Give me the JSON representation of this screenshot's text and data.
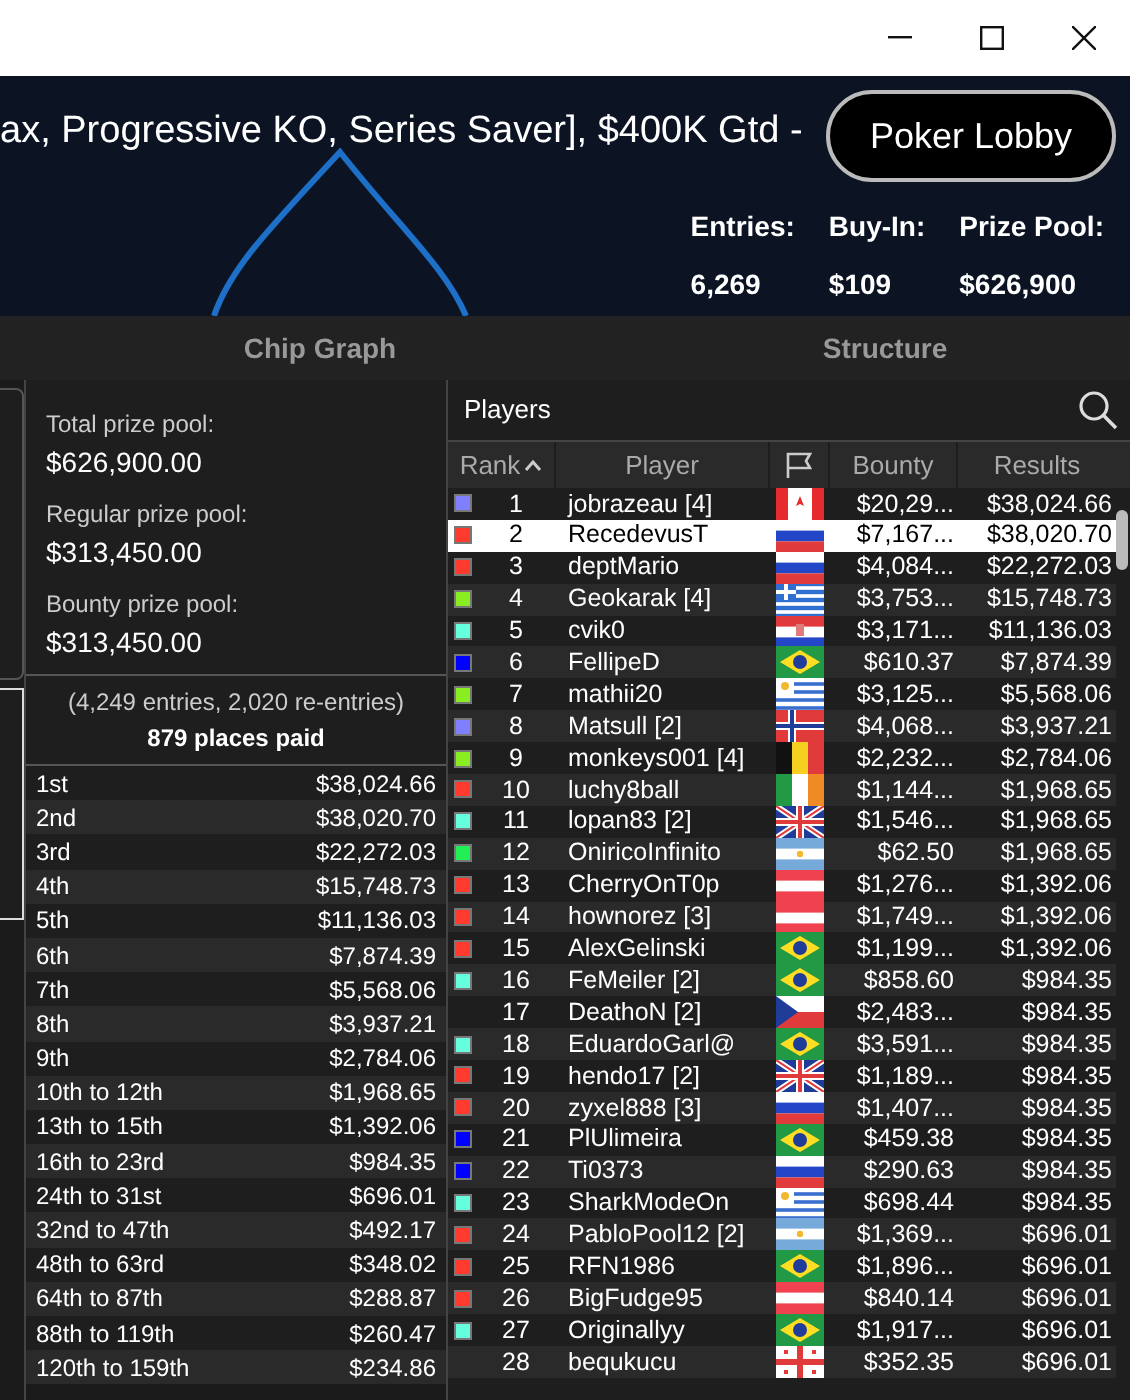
{
  "header": {
    "title": "ax, Progressive KO, Series Saver], $400K Gtd -",
    "lobby_button": "Poker Lobby",
    "stats": [
      {
        "label": "Entries:",
        "value": "6,269"
      },
      {
        "label": "Buy-In:",
        "value": "$109"
      },
      {
        "label": "Prize Pool:",
        "value": "$626,900"
      }
    ]
  },
  "tabs": [
    {
      "label": "Chip Graph",
      "selected": false
    },
    {
      "label": "Structure",
      "selected": false
    }
  ],
  "prize_summary": [
    {
      "label": "Total prize pool:",
      "value": "$626,900.00"
    },
    {
      "label": "Regular prize pool:",
      "value": "$313,450.00"
    },
    {
      "label": "Bounty prize pool:",
      "value": "$313,450.00"
    }
  ],
  "entries_note": "(4,249 entries, 2,020 re-entries)",
  "places_paid": "879 places paid",
  "payouts": [
    {
      "place": "1st",
      "amount": "$38,024.66"
    },
    {
      "place": "2nd",
      "amount": "$38,020.70"
    },
    {
      "place": "3rd",
      "amount": "$22,272.03"
    },
    {
      "place": "4th",
      "amount": "$15,748.73"
    },
    {
      "place": "5th",
      "amount": "$11,136.03"
    },
    {
      "place": "6th",
      "amount": "$7,874.39"
    },
    {
      "place": "7th",
      "amount": "$5,568.06"
    },
    {
      "place": "8th",
      "amount": "$3,937.21"
    },
    {
      "place": "9th",
      "amount": "$2,784.06"
    },
    {
      "place": "10th to 12th",
      "amount": "$1,968.65"
    },
    {
      "place": "13th to 15th",
      "amount": "$1,392.06"
    },
    {
      "place": "16th to 23rd",
      "amount": "$984.35"
    },
    {
      "place": "24th to 31st",
      "amount": "$696.01"
    },
    {
      "place": "32nd to 47th",
      "amount": "$492.17"
    },
    {
      "place": "48th to 63rd",
      "amount": "$348.02"
    },
    {
      "place": "64th to 87th",
      "amount": "$288.87"
    },
    {
      "place": "88th to 119th",
      "amount": "$260.47"
    },
    {
      "place": "120th to 159th",
      "amount": "$234.86"
    }
  ],
  "players": {
    "title": "Players",
    "columns": [
      "Rank",
      "Player",
      "Bounty",
      "Results"
    ],
    "rows": [
      {
        "rank": "1",
        "name": "jobrazeau [4]",
        "flag": {
          "kind": "ca"
        },
        "bounty": "$20,29...",
        "result": "$38,024.66",
        "color": "#8080ff",
        "selected": false
      },
      {
        "rank": "2",
        "name": "RecedevusT",
        "flag": {
          "kind": "ru"
        },
        "bounty": "$7,167...",
        "result": "$38,020.70",
        "color": "#ff3b30",
        "selected": true
      },
      {
        "rank": "3",
        "name": "deptMario",
        "flag": {
          "kind": "ru"
        },
        "bounty": "$4,084...",
        "result": "$22,272.03",
        "color": "#ff3b30",
        "selected": false
      },
      {
        "rank": "4",
        "name": "Geokarak [4]",
        "flag": {
          "kind": "gr"
        },
        "bounty": "$3,753...",
        "result": "$15,748.73",
        "color": "#88ee22",
        "selected": false
      },
      {
        "rank": "5",
        "name": "cvik0",
        "flag": {
          "kind": "hr"
        },
        "bounty": "$3,171...",
        "result": "$11,136.03",
        "color": "#66ffdd",
        "selected": false
      },
      {
        "rank": "6",
        "name": "FellipeD",
        "flag": {
          "kind": "br"
        },
        "bounty": "$610.37",
        "result": "$7,874.39",
        "color": "#0000ff",
        "selected": false
      },
      {
        "rank": "7",
        "name": "mathii20",
        "flag": {
          "kind": "uy"
        },
        "bounty": "$3,125...",
        "result": "$5,568.06",
        "color": "#88ee22",
        "selected": false
      },
      {
        "rank": "8",
        "name": "Matsull [2]",
        "flag": {
          "kind": "no"
        },
        "bounty": "$4,068...",
        "result": "$3,937.21",
        "color": "#8080ff",
        "selected": false
      },
      {
        "rank": "9",
        "name": "monkeys001 [4]",
        "flag": {
          "kind": "be"
        },
        "bounty": "$2,232...",
        "result": "$2,784.06",
        "color": "#88ee22",
        "selected": false
      },
      {
        "rank": "10",
        "name": "luchy8ball",
        "flag": {
          "kind": "ie"
        },
        "bounty": "$1,144...",
        "result": "$1,968.65",
        "color": "#ff3b30",
        "selected": false
      },
      {
        "rank": "11",
        "name": "lopan83 [2]",
        "flag": {
          "kind": "gb"
        },
        "bounty": "$1,546...",
        "result": "$1,968.65",
        "color": "#66ffdd",
        "selected": false
      },
      {
        "rank": "12",
        "name": "OniricoInfinito",
        "flag": {
          "kind": "ar"
        },
        "bounty": "$62.50",
        "result": "$1,968.65",
        "color": "#22ee55",
        "selected": false
      },
      {
        "rank": "13",
        "name": "CherryOnT0p",
        "flag": {
          "kind": "at"
        },
        "bounty": "$1,276...",
        "result": "$1,392.06",
        "color": "#ff3b30",
        "selected": false
      },
      {
        "rank": "14",
        "name": "hownorez [3]",
        "flag": {
          "kind": "at"
        },
        "bounty": "$1,749...",
        "result": "$1,392.06",
        "color": "#ff3b30",
        "selected": false
      },
      {
        "rank": "15",
        "name": "AlexGelinski",
        "flag": {
          "kind": "br"
        },
        "bounty": "$1,199...",
        "result": "$1,392.06",
        "color": "#ff3b30",
        "selected": false
      },
      {
        "rank": "16",
        "name": "FeMeiler [2]",
        "flag": {
          "kind": "br"
        },
        "bounty": "$858.60",
        "result": "$984.35",
        "color": "#66ffdd",
        "selected": false
      },
      {
        "rank": "17",
        "name": "DeathoN [2]",
        "flag": {
          "kind": "cz"
        },
        "bounty": "$2,483...",
        "result": "$984.35",
        "selected": false
      },
      {
        "rank": "18",
        "name": "EduardoGarl@",
        "flag": {
          "kind": "br"
        },
        "bounty": "$3,591...",
        "result": "$984.35",
        "color": "#66ffdd",
        "selected": false
      },
      {
        "rank": "19",
        "name": "hendo17 [2]",
        "flag": {
          "kind": "gb"
        },
        "bounty": "$1,189...",
        "result": "$984.35",
        "color": "#ff3b30",
        "selected": false
      },
      {
        "rank": "20",
        "name": "zyxel888 [3]",
        "flag": {
          "kind": "ru"
        },
        "bounty": "$1,407...",
        "result": "$984.35",
        "color": "#ff3b30",
        "selected": false
      },
      {
        "rank": "21",
        "name": "PlUlimeira",
        "flag": {
          "kind": "br"
        },
        "bounty": "$459.38",
        "result": "$984.35",
        "color": "#0000ff",
        "selected": false
      },
      {
        "rank": "22",
        "name": "Ti0373",
        "flag": {
          "kind": "ru"
        },
        "bounty": "$290.63",
        "result": "$984.35",
        "color": "#0000ff",
        "selected": false
      },
      {
        "rank": "23",
        "name": "SharkModeOn",
        "flag": {
          "kind": "uy"
        },
        "bounty": "$698.44",
        "result": "$984.35",
        "color": "#66ffdd",
        "selected": false
      },
      {
        "rank": "24",
        "name": "PabloPool12 [2]",
        "flag": {
          "kind": "ar"
        },
        "bounty": "$1,369...",
        "result": "$696.01",
        "color": "#ff3b30",
        "selected": false
      },
      {
        "rank": "25",
        "name": "RFN1986",
        "flag": {
          "kind": "br"
        },
        "bounty": "$1,896...",
        "result": "$696.01",
        "color": "#ff3b30",
        "selected": false
      },
      {
        "rank": "26",
        "name": "BigFudge95",
        "flag": {
          "kind": "at"
        },
        "bounty": "$840.14",
        "result": "$696.01",
        "color": "#ff3b30",
        "selected": false
      },
      {
        "rank": "27",
        "name": "Originallyy",
        "flag": {
          "kind": "br"
        },
        "bounty": "$1,917...",
        "result": "$696.01",
        "color": "#66ffdd",
        "selected": false
      },
      {
        "rank": "28",
        "name": "bequkucu",
        "flag": {
          "kind": "ge"
        },
        "bounty": "$352.35",
        "result": "$696.01",
        "selected": false
      }
    ]
  }
}
